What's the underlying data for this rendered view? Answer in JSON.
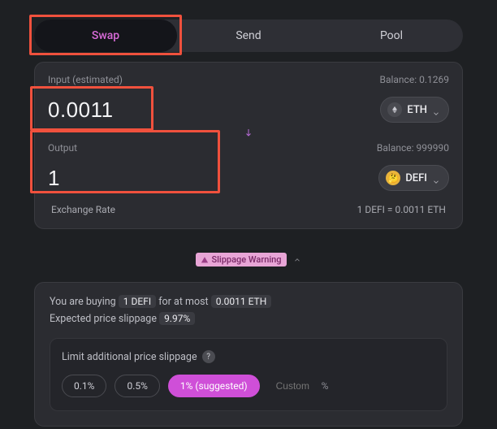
{
  "tabs": {
    "swap": "Swap",
    "send": "Send",
    "pool": "Pool"
  },
  "input": {
    "label": "Input (estimated)",
    "balance_label": "Balance:",
    "balance": "0.1269",
    "amount": "0.0011",
    "token_symbol": "ETH"
  },
  "output": {
    "label": "Output",
    "balance_label": "Balance:",
    "balance": "999990",
    "amount": "1",
    "token_symbol": "DEFI"
  },
  "exchange_rate": {
    "label": "Exchange Rate",
    "value": "1 DEFI = 0.0011 ETH"
  },
  "slippage_warning": "Slippage Warning",
  "summary": {
    "prefix": "You are buying",
    "buy_amount": "1 DEFI",
    "mid": "for at most",
    "cost": "0.0011 ETH",
    "expected_label": "Expected price slippage",
    "expected_value": "9.97%"
  },
  "limit": {
    "label": "Limit additional price slippage",
    "options": {
      "a": "0.1%",
      "b": "0.5%",
      "c": "1% (suggested)"
    },
    "custom_placeholder": "Custom",
    "pct": "%"
  }
}
